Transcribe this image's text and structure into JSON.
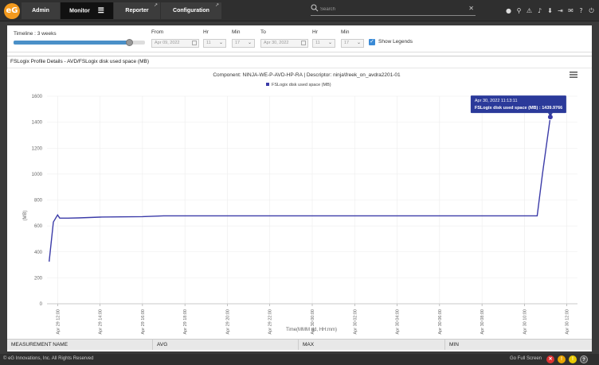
{
  "nav": {
    "admin": "Admin",
    "monitor": "Monitor",
    "reporter": "Reporter",
    "configuration": "Configuration"
  },
  "search": {
    "placeholder": "Search"
  },
  "filters": {
    "timeline": "Timeline : 3 weeks",
    "timeline_fraction": 0.88,
    "from_label": "From",
    "from_date": "Apr 09, 2022",
    "hr_label": "Hr",
    "min_label": "Min",
    "from_hr": "11",
    "from_min": "17",
    "to_label": "To",
    "to_date": "Apr 30, 2022",
    "to_hr": "11",
    "to_min": "17",
    "show_legends": "Show Legends"
  },
  "card": {
    "title": "FSLogix Profile Details - AVD/FSLogix disk used space (MB)"
  },
  "tooltip": {
    "line1": "Apr 30, 2022 11:13:11",
    "line2": "FSLogix disk used space (MB) : 1439.9766"
  },
  "table": {
    "headers": [
      "MEASUREMENT NAME",
      "AVG",
      "MAX",
      "MIN"
    ]
  },
  "footer": {
    "copyright": "© eG Innovations, Inc. All Rights Reserved",
    "fullscreen": "Go Full Screen"
  },
  "colors": {
    "series": "#3b3ba8",
    "tooltip_bg": "#2b3a9a",
    "accent": "#4a90c8"
  },
  "chart_data": {
    "type": "line",
    "title": "Component: NINJA-WE-P-AVD-HP-RA | Descriptor: ninja\\freek_on_avdra2201-01",
    "xlabel": "Time(MMM dd, HH:mm)",
    "ylabel": "(MB)",
    "ylim": [
      0,
      1600
    ],
    "yticks": [
      0,
      200,
      400,
      600,
      800,
      1000,
      1200,
      1400,
      1600
    ],
    "xticks": [
      "Apr 29 12:00",
      "Apr 29 14:00",
      "Apr 29 16:00",
      "Apr 29 18:00",
      "Apr 29 20:00",
      "Apr 29 22:00",
      "Apr 30 00:00",
      "Apr 30 02:00",
      "Apr 30 04:00",
      "Apr 30 06:00",
      "Apr 30 08:00",
      "Apr 30 10:00",
      "Apr 30 12:00"
    ],
    "xrange_hours": [
      -0.5,
      24.5
    ],
    "legend_placement": "top-center",
    "series": [
      {
        "name": "FSLogix disk used space (MB)",
        "points": [
          [
            -0.4,
            325
          ],
          [
            -0.2,
            630
          ],
          [
            0.0,
            685
          ],
          [
            0.1,
            660
          ],
          [
            0.5,
            660
          ],
          [
            1.0,
            662
          ],
          [
            2.0,
            668
          ],
          [
            3.0,
            670
          ],
          [
            4.0,
            672
          ],
          [
            5.0,
            678
          ],
          [
            8.0,
            678
          ],
          [
            12.0,
            678
          ],
          [
            16.0,
            678
          ],
          [
            20.0,
            678
          ],
          [
            22.6,
            678
          ],
          [
            22.85,
            1000
          ],
          [
            23.22,
            1439.9766
          ]
        ]
      }
    ]
  }
}
